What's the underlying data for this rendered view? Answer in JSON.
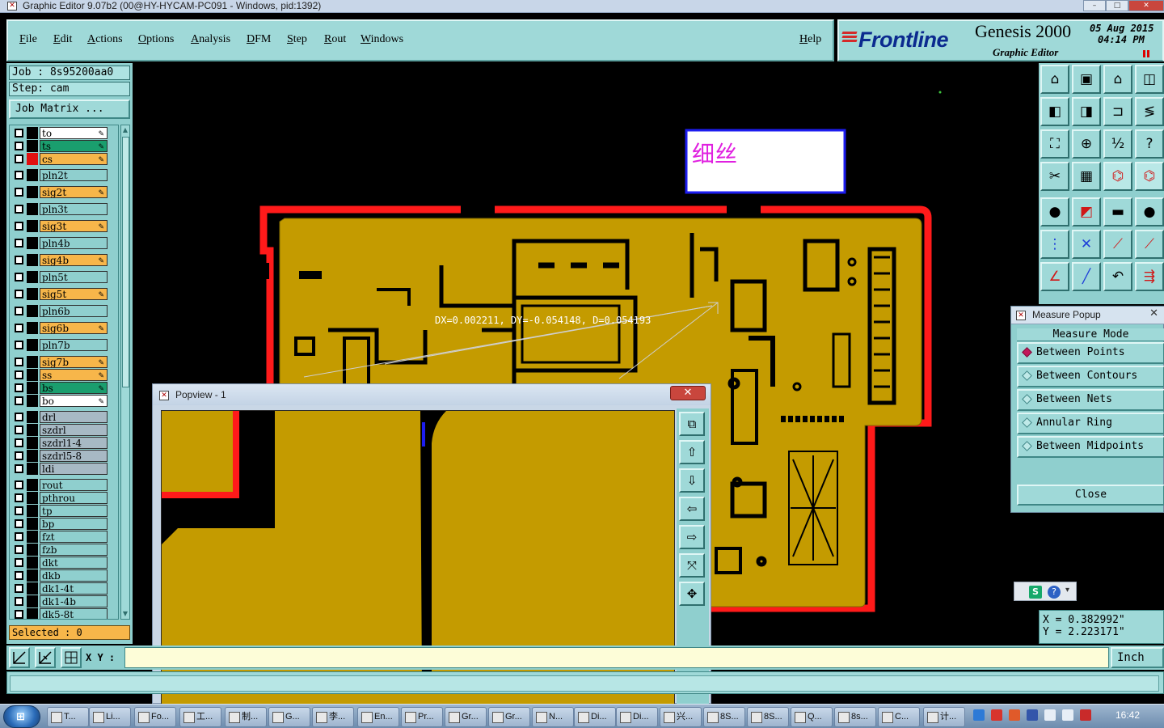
{
  "window": {
    "title": "Graphic Editor 9.07b2 (00@HY-HYCAM-PC091 - Windows, pid:1392)",
    "controls": [
      "–",
      "□",
      "✕"
    ]
  },
  "menu": [
    "File",
    "Edit",
    "Actions",
    "Options",
    "Analysis",
    "DFM",
    "Step",
    "Rout",
    "Windows"
  ],
  "help_label": "Help",
  "brand": {
    "logo": "Frontline",
    "product": "Genesis 2000",
    "subtitle": "Graphic Editor",
    "date": "05 Aug 2015",
    "time": "04:14 PM"
  },
  "job": {
    "job_line": "Job : 8s95200aa0",
    "step_line": "Step: cam",
    "matrix_label": "Job Matrix ..."
  },
  "layers": [
    {
      "name": "to",
      "color": "#ffffff",
      "swatch": "#000000",
      "pen": true
    },
    {
      "name": "ts",
      "color": "#1a9e6e",
      "swatch": "#000000",
      "pen": true
    },
    {
      "name": "cs",
      "color": "#f7b64a",
      "swatch": "#e01010",
      "pen": true
    },
    {
      "name": "pln2t",
      "color": "#8fcfce",
      "swatch": "#000000",
      "pen": false
    },
    {
      "name": "sig2t",
      "color": "#f7b64a",
      "swatch": "#000000",
      "pen": true
    },
    {
      "name": "pln3t",
      "color": "#8fcfce",
      "swatch": "#000000",
      "pen": false
    },
    {
      "name": "sig3t",
      "color": "#f7b64a",
      "swatch": "#000000",
      "pen": true
    },
    {
      "name": "pln4b",
      "color": "#8fcfce",
      "swatch": "#000000",
      "pen": false
    },
    {
      "name": "sig4b",
      "color": "#f7b64a",
      "swatch": "#000000",
      "pen": true
    },
    {
      "name": "pln5t",
      "color": "#8fcfce",
      "swatch": "#000000",
      "pen": false
    },
    {
      "name": "sig5t",
      "color": "#f7b64a",
      "swatch": "#000000",
      "pen": true
    },
    {
      "name": "pln6b",
      "color": "#8fcfce",
      "swatch": "#000000",
      "pen": false
    },
    {
      "name": "sig6b",
      "color": "#f7b64a",
      "swatch": "#000000",
      "pen": true
    },
    {
      "name": "pln7b",
      "color": "#8fcfce",
      "swatch": "#000000",
      "pen": false
    },
    {
      "name": "sig7b",
      "color": "#f7b64a",
      "swatch": "#000000",
      "pen": true
    },
    {
      "name": "ss",
      "color": "#f7b64a",
      "swatch": "#000000",
      "pen": true
    },
    {
      "name": "bs",
      "color": "#1a9e6e",
      "swatch": "#000000",
      "pen": true
    },
    {
      "name": "bo",
      "color": "#ffffff",
      "swatch": "#000000",
      "pen": true
    },
    {
      "name": "drl",
      "color": "#a7b9c4",
      "swatch": "#000000",
      "pen": false
    },
    {
      "name": "szdrl",
      "color": "#a7b9c4",
      "swatch": "#000000",
      "pen": false
    },
    {
      "name": "szdrl1-4",
      "color": "#a7b9c4",
      "swatch": "#000000",
      "pen": false
    },
    {
      "name": "szdrl5-8",
      "color": "#a7b9c4",
      "swatch": "#000000",
      "pen": false
    },
    {
      "name": "ldi",
      "color": "#a7b9c4",
      "swatch": "#000000",
      "pen": false
    },
    {
      "name": "rout",
      "color": "#8fcfce",
      "swatch": "#000000",
      "pen": false
    },
    {
      "name": "pthrou",
      "color": "#8fcfce",
      "swatch": "#000000",
      "pen": false
    },
    {
      "name": "tp",
      "color": "#8fcfce",
      "swatch": "#000000",
      "pen": false
    },
    {
      "name": "bp",
      "color": "#8fcfce",
      "swatch": "#000000",
      "pen": false
    },
    {
      "name": "fzt",
      "color": "#8fcfce",
      "swatch": "#000000",
      "pen": false
    },
    {
      "name": "fzb",
      "color": "#8fcfce",
      "swatch": "#000000",
      "pen": false
    },
    {
      "name": "dkt",
      "color": "#8fcfce",
      "swatch": "#000000",
      "pen": false
    },
    {
      "name": "dkb",
      "color": "#8fcfce",
      "swatch": "#000000",
      "pen": false
    },
    {
      "name": "dk1-4t",
      "color": "#8fcfce",
      "swatch": "#000000",
      "pen": false
    },
    {
      "name": "dk1-4b",
      "color": "#8fcfce",
      "swatch": "#000000",
      "pen": false
    },
    {
      "name": "dk5-8t",
      "color": "#8fcfce",
      "swatch": "#000000",
      "pen": false
    }
  ],
  "selected_label": "Selected : 0",
  "xy_label": "X Y :",
  "xy_value": "",
  "unit_label": "Inch",
  "board": {
    "annotation": "细丝",
    "measure_text": "DX=0.002211, DY=-0.054148, D=0.054193"
  },
  "measure_popup": {
    "title": "Measure Popup",
    "heading": "Measure Mode",
    "options": [
      "Between Points",
      "Between Contours",
      "Between Nets",
      "Annular Ring",
      "Between Midpoints"
    ],
    "selected_option": "Between Points",
    "close_label": "Close"
  },
  "coords": {
    "x": "X = 0.382992\"",
    "y": "Y = 2.223171\""
  },
  "popview": {
    "title": "Popview - 1",
    "close": "✕"
  },
  "taskbar": {
    "items": [
      "T...",
      "Li...",
      "Fo...",
      "工...",
      "制...",
      "G...",
      "李...",
      "En...",
      "Pr...",
      "Gr...",
      "Gr...",
      "N...",
      "Di...",
      "Di...",
      "兴...",
      "8S...",
      "8S...",
      "Q...",
      "8s...",
      "C...",
      "计..."
    ],
    "clock": "16:42"
  },
  "colors": {
    "panel": "#8fcfce",
    "board_copper": "#c49b00",
    "outline": "#ff1a1a",
    "accent": "#0b2a8f"
  }
}
